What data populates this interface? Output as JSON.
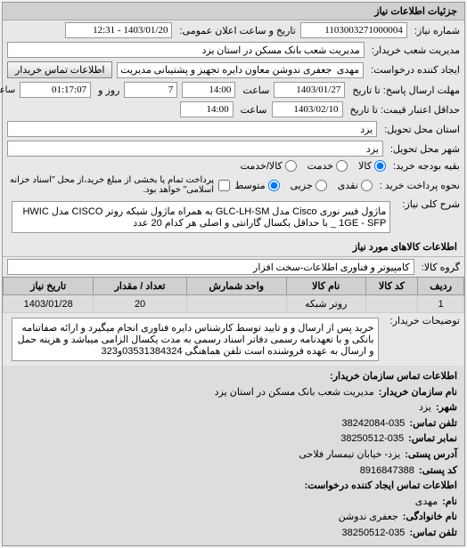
{
  "panel_title": "جزئیات اطلاعات نیاز",
  "form": {
    "req_number_label": "شماره نیاز:",
    "req_number": "1103003271000004",
    "announce_label": "تاریخ و ساعت اعلان عمومی:",
    "announce_value": "1403/01/20 - 12:31",
    "buyer_mgmt_label": "مدیریت شعب خریدار:",
    "buyer_mgmt": "مدیریت شعب بانک مسکن در استان یزد",
    "requester_label": "ایجاد کننده درخواست:",
    "requester": "مهدی  جعفری ندوشن معاون دایره تجهیز و پشتیبانی مدیریت شعب بانک مسکن",
    "buyer_contact_btn": "اطلاعات تماس خریدار",
    "deadline_label": "مهلت ارسال پاسخ: تا تاریخ",
    "deadline_date": "1403/01/27",
    "deadline_time_label": "ساعت",
    "deadline_time": "14:00",
    "remaining_days": "7",
    "remaining_days_label": "روز و",
    "remaining_time": "01:17:07",
    "remaining_time_label": "ساعت باقی مانده",
    "validity_label": "حداقل اعتبار قیمت: تا تاریخ",
    "validity_date": "1403/02/10",
    "validity_time_label": "ساعت",
    "validity_time": "14:00",
    "delivery_province_label": "استان محل تحویل:",
    "delivery_province": "یزد",
    "delivery_city_label": "شهر محل تحویل:",
    "delivery_city": "یزد",
    "budget_row_label": "بقیه بودجه خرید:",
    "budget_radios": {
      "cash": "کالا",
      "credit": "خدمت",
      "partial": "کالا/خدمت"
    },
    "pay_method_label": "نحوه پرداخت خرید :",
    "pay_radios": {
      "cash": "نقدی",
      "credit": "جزیی",
      "partial": "متوسط"
    },
    "pay_note": "پرداخت تمام یا بخشی از مبلغ خرید،از محل \"اسناد خزانه اسلامی\" خواهد بود.",
    "desc_label": "شرح کلی نیاز:",
    "desc_text": "ماژول فیبر نوری Cisco مدل GLC-LH-SM به همراه ماژول شبکه روتر CISCO مدل HWIC _ 1GE - SFP با حداقل یکسال گارانتی و اصلی هر کدام 20 عدد"
  },
  "goods_section": {
    "title": "اطلاعات کالاهای مورد نیاز",
    "group_label": "گروه کالا:",
    "group_value": "کامپیوتر و فناوری اطلاعات-سخت افزار",
    "table": {
      "headers": [
        "ردیف",
        "کد کالا",
        "نام کالا",
        "واحد شمارش",
        "تعداد / مقدار",
        "تاریخ نیاز"
      ],
      "rows": [
        [
          "1",
          "",
          "روتر شبکه",
          "",
          "20",
          "1403/01/28"
        ]
      ]
    },
    "notes_label": "توضیحات خریدار:",
    "notes_text": "خرید پس از ارسال و و تایید توسط کارشناس دایره فناوری انجام میگیرد و ارائه صفاتنامه بانکی و با تعهدنامه رسمی دفاتر اسناد رسمی به مدت یکسال الزامی میباشد و هزینه حمل و ارسال به عهده فروشنده است تلفن هماهنگی 03531384324و323"
  },
  "contact_section": {
    "title": "اطلاعات تماس سازمان خریدار:",
    "org_label": "نام سازمان خریدار:",
    "org_value": "مدیریت شعب بانک مسکن در استان یزد",
    "city_label": "شهر:",
    "city_value": "یزد",
    "phone_label": "تلفن تماس:",
    "phone_value": "38242084-035",
    "fax_label": "نمابر تماس:",
    "fax_value": "38250512-035",
    "post_addr_label": "آدرس پستی:",
    "post_addr_value": "یزد- خیابان تیمسار فلاحی",
    "post_code_label": "کد پستی:",
    "post_code_value": "8916847388",
    "req_contact_title": "اطلاعات تماس ایجاد کننده درخواست:",
    "name_label": "نام:",
    "name_value": "مهدی",
    "family_label": "نام خانوادگی:",
    "family_value": "جعفری ندوشن",
    "req_phone_label": "تلفن تماس:",
    "req_phone_value": "38250512-035"
  }
}
